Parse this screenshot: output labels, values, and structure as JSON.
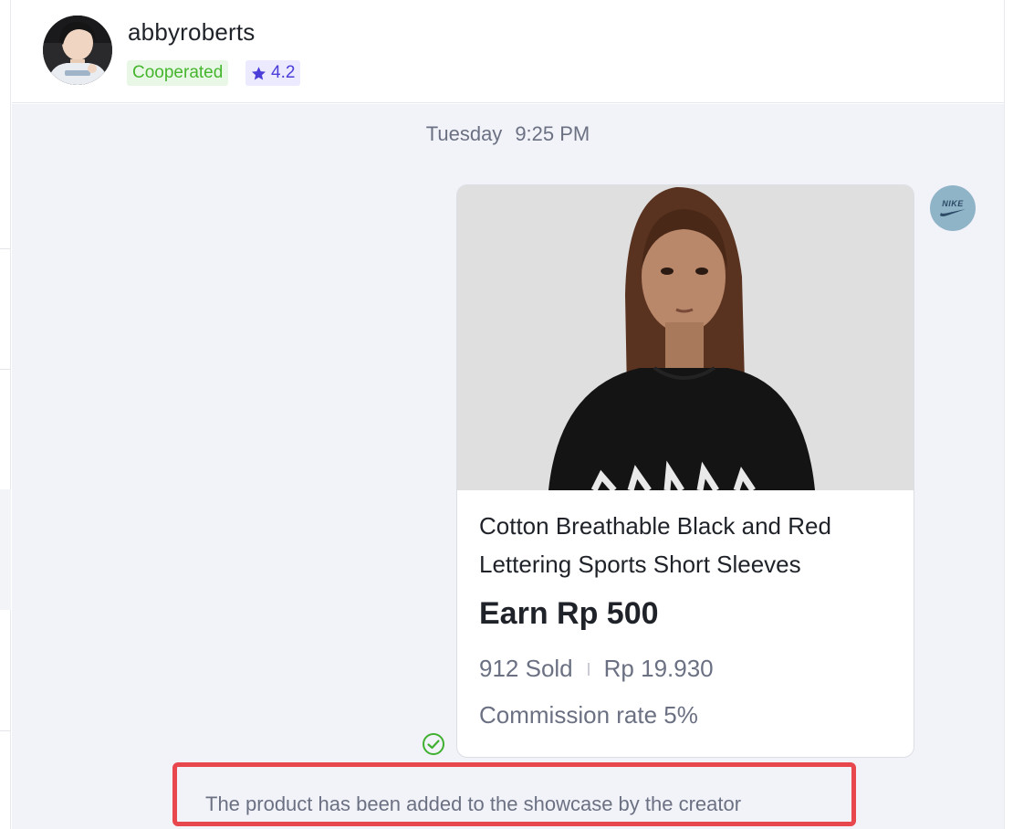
{
  "creator": {
    "username": "abbyroberts",
    "status_badge": "Cooperated",
    "rating": "4.2",
    "avatar_icon": "profile-photo"
  },
  "chat": {
    "timestamp_day": "Tuesday",
    "timestamp_time": "9:25 PM",
    "brand_avatar_icon": "nike-logo",
    "brand_avatar_text": "NIKE"
  },
  "product_card": {
    "title": "Cotton Breathable Black and Red Lettering Sports Short Sleeves",
    "earn": "Earn Rp 500",
    "sold": "912 Sold",
    "price": "Rp 19.930",
    "commission": "Commission rate 5%",
    "image_icon": "product-photo"
  },
  "status": {
    "check_icon": "check-circle-icon",
    "notice": "The product has been added to the showcase by the creator"
  },
  "colors": {
    "cooperated_green": "#45b52d",
    "rating_purple": "#4a3dd8",
    "highlight_red": "#e8474d",
    "chat_background": "#f2f3f8"
  }
}
